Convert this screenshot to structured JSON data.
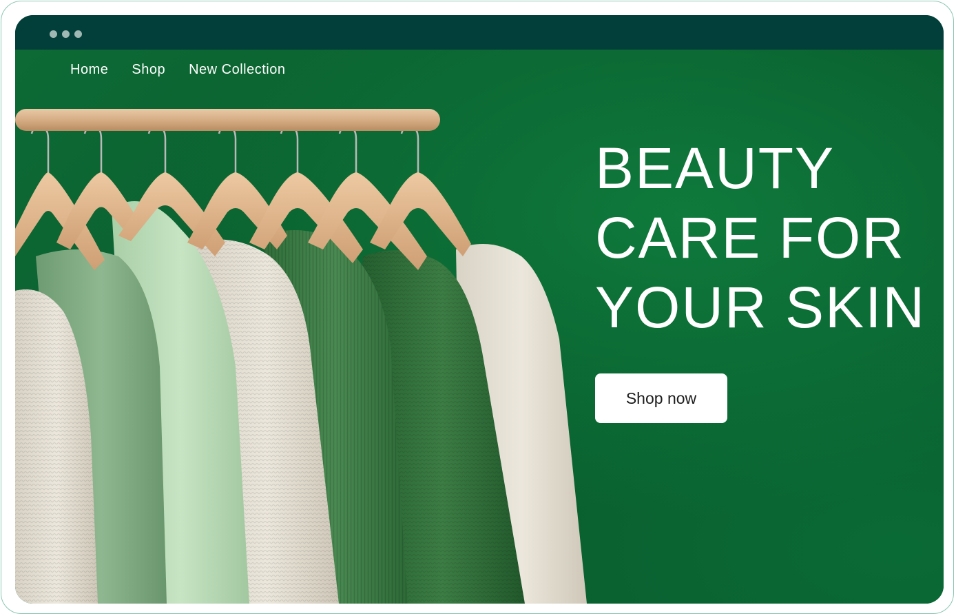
{
  "window": {
    "controls": [
      "dot",
      "dot",
      "dot"
    ]
  },
  "nav": {
    "items": [
      "Home",
      "Shop",
      "New Collection"
    ]
  },
  "hero": {
    "headline_lines": [
      "BEAUTY",
      "CARE FOR",
      "YOUR SKIN"
    ],
    "cta_label": "Shop now",
    "image_subject": "clothes-rack-icon"
  },
  "colors": {
    "titlebar": "#023f3a",
    "hero_background": "#0b5a2f",
    "button_background": "#ffffff",
    "frame_border": "#8cc7b3"
  }
}
